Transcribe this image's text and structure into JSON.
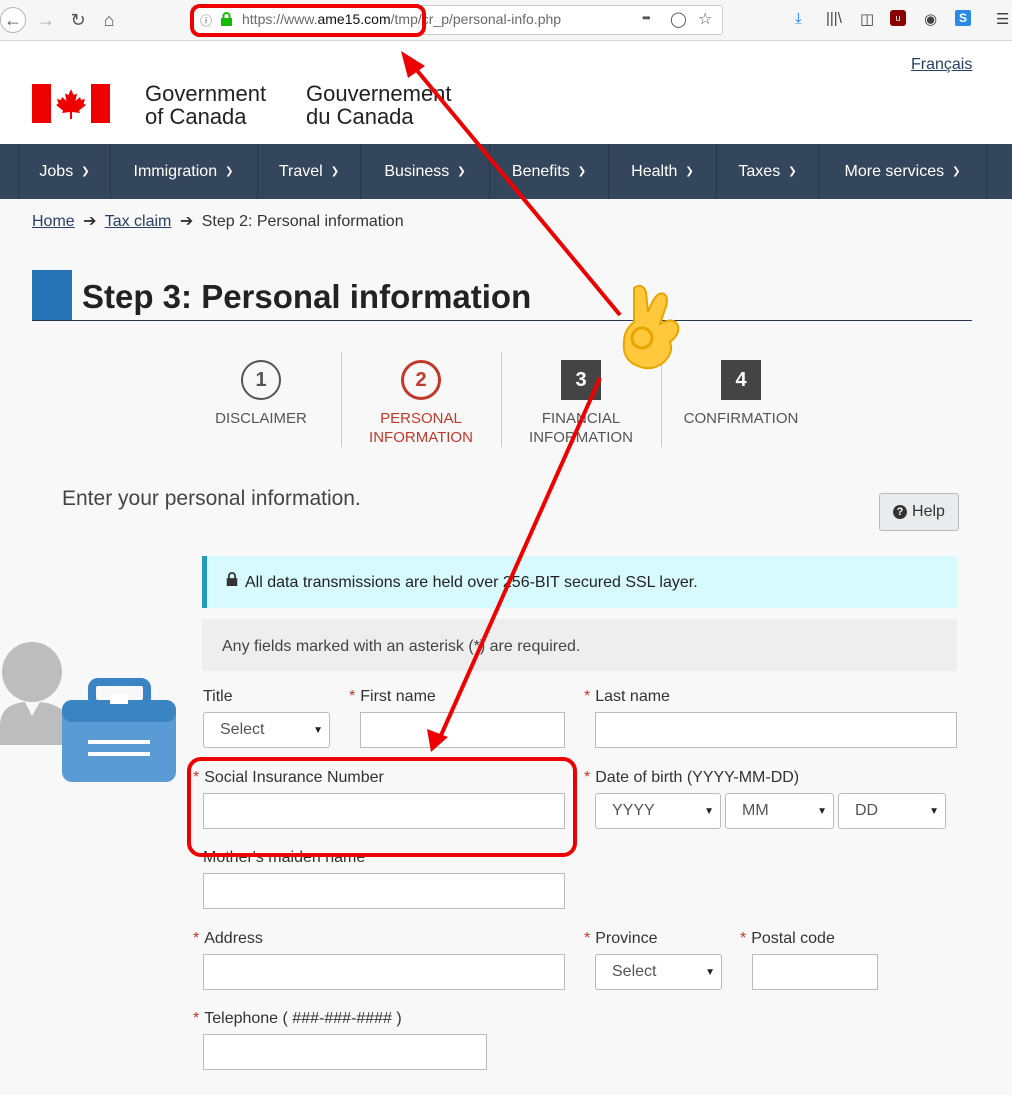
{
  "browser": {
    "url_prefix": "https://www.",
    "url_domain": "ame15.com",
    "url_path": "/tmp/cr_p/personal-info.php",
    "more_icon": "•••"
  },
  "header": {
    "gov_en_line1": "Government",
    "gov_en_line2": "of Canada",
    "gov_fr_line1": "Gouvernement",
    "gov_fr_line2": "du Canada",
    "language_link": "Français"
  },
  "menu": {
    "items": [
      "Jobs",
      "Immigration",
      "Travel",
      "Business",
      "Benefits",
      "Health",
      "Taxes",
      "More services"
    ]
  },
  "breadcrumb": {
    "home": "Home",
    "tax_claim": "Tax claim",
    "current": "Step 2: Personal information",
    "separator": "➔"
  },
  "page": {
    "title": "Step 3: Personal information",
    "intro": "Enter your personal information.",
    "help_label": "Help",
    "ssl_notice": "All data transmissions are held over 256-BIT secured SSL layer.",
    "required_notice": "Any fields marked with an asterisk (*) are required."
  },
  "steps": [
    {
      "number": "1",
      "line1": "DISCLAIMER",
      "line2": ""
    },
    {
      "number": "2",
      "line1": "PERSONAL",
      "line2": "INFORMATION"
    },
    {
      "number": "3",
      "line1": "FINANCIAL",
      "line2": "INFORMATION"
    },
    {
      "number": "4",
      "line1": "CONFIRMATION",
      "line2": ""
    }
  ],
  "form": {
    "asterisk": "*",
    "title_label": "Title",
    "title_select": "Select",
    "first_name_label": "First name",
    "last_name_label": "Last name",
    "sin_label": "Social Insurance Number",
    "dob_label": "Date of birth (YYYY-MM-DD)",
    "dob_year": "YYYY",
    "dob_month": "MM",
    "dob_day": "DD",
    "maiden_label": "Mother's maiden name",
    "address_label": "Address",
    "province_label": "Province",
    "province_select": "Select",
    "postal_label": "Postal code",
    "telephone_label": "Telephone ( ###-###-#### )"
  },
  "colors": {
    "menu_bg": "#33465c",
    "active_step": "#c0392b",
    "annotation": "#e00000",
    "ssl_bg": "#d7faff"
  }
}
